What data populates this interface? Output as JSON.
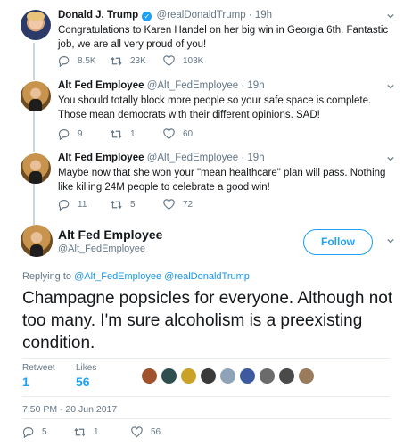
{
  "replies": [
    {
      "name": "Donald J. Trump",
      "handle": "@realDonaldTrump",
      "separator": "·",
      "time": "19h",
      "verified": true,
      "text": "Congratulations to Karen Handel on her big win in Georgia 6th. Fantastic job, we are all very proud of you!",
      "reply_count": "8.5K",
      "retweet_count": "23K",
      "like_count": "103K"
    },
    {
      "name": "Alt Fed Employee",
      "handle": "@Alt_FedEmployee",
      "separator": "·",
      "time": "19h",
      "verified": false,
      "text": "You should totally block more people so your safe space is complete. Those mean democrats with their different opinions. SAD!",
      "reply_count": "9",
      "retweet_count": "1",
      "like_count": "60"
    },
    {
      "name": "Alt Fed Employee",
      "handle": "@Alt_FedEmployee",
      "separator": "·",
      "time": "19h",
      "verified": false,
      "text": "Maybe now that she won your \"mean healthcare\" plan will pass. Nothing like killing 24M people to celebrate a good win!",
      "reply_count": "11",
      "retweet_count": "5",
      "like_count": "72"
    }
  ],
  "main_tweet": {
    "name": "Alt Fed Employee",
    "handle": "@Alt_FedEmployee",
    "follow_label": "Follow",
    "replying_prefix": "Replying to",
    "replying_mention_1": "@Alt_FedEmployee",
    "replying_mention_2": "@realDonaldTrump",
    "text": "Champagne popsicles for everyone. Although not too many. I'm sure alcoholism is a preexisting condition.",
    "retweets_label": "Retweet",
    "retweets_count": "1",
    "likes_label": "Likes",
    "likes_count": "56",
    "timestamp": "7:50 PM - 20 Jun 2017",
    "reply_count": "5",
    "retweet_count": "1",
    "like_count": "56"
  },
  "colors": {
    "accent": "#1da1f2",
    "muted": "#657786",
    "text": "#14171a",
    "divider": "#e6ecf0"
  },
  "liker_colors": [
    "#a0522d",
    "#2f4f4f",
    "#c9a227",
    "#3a3a3a",
    "#8fa3b8",
    "#3d5a9e",
    "#6b6b6b",
    "#4a4a4a",
    "#9a7b5b"
  ]
}
